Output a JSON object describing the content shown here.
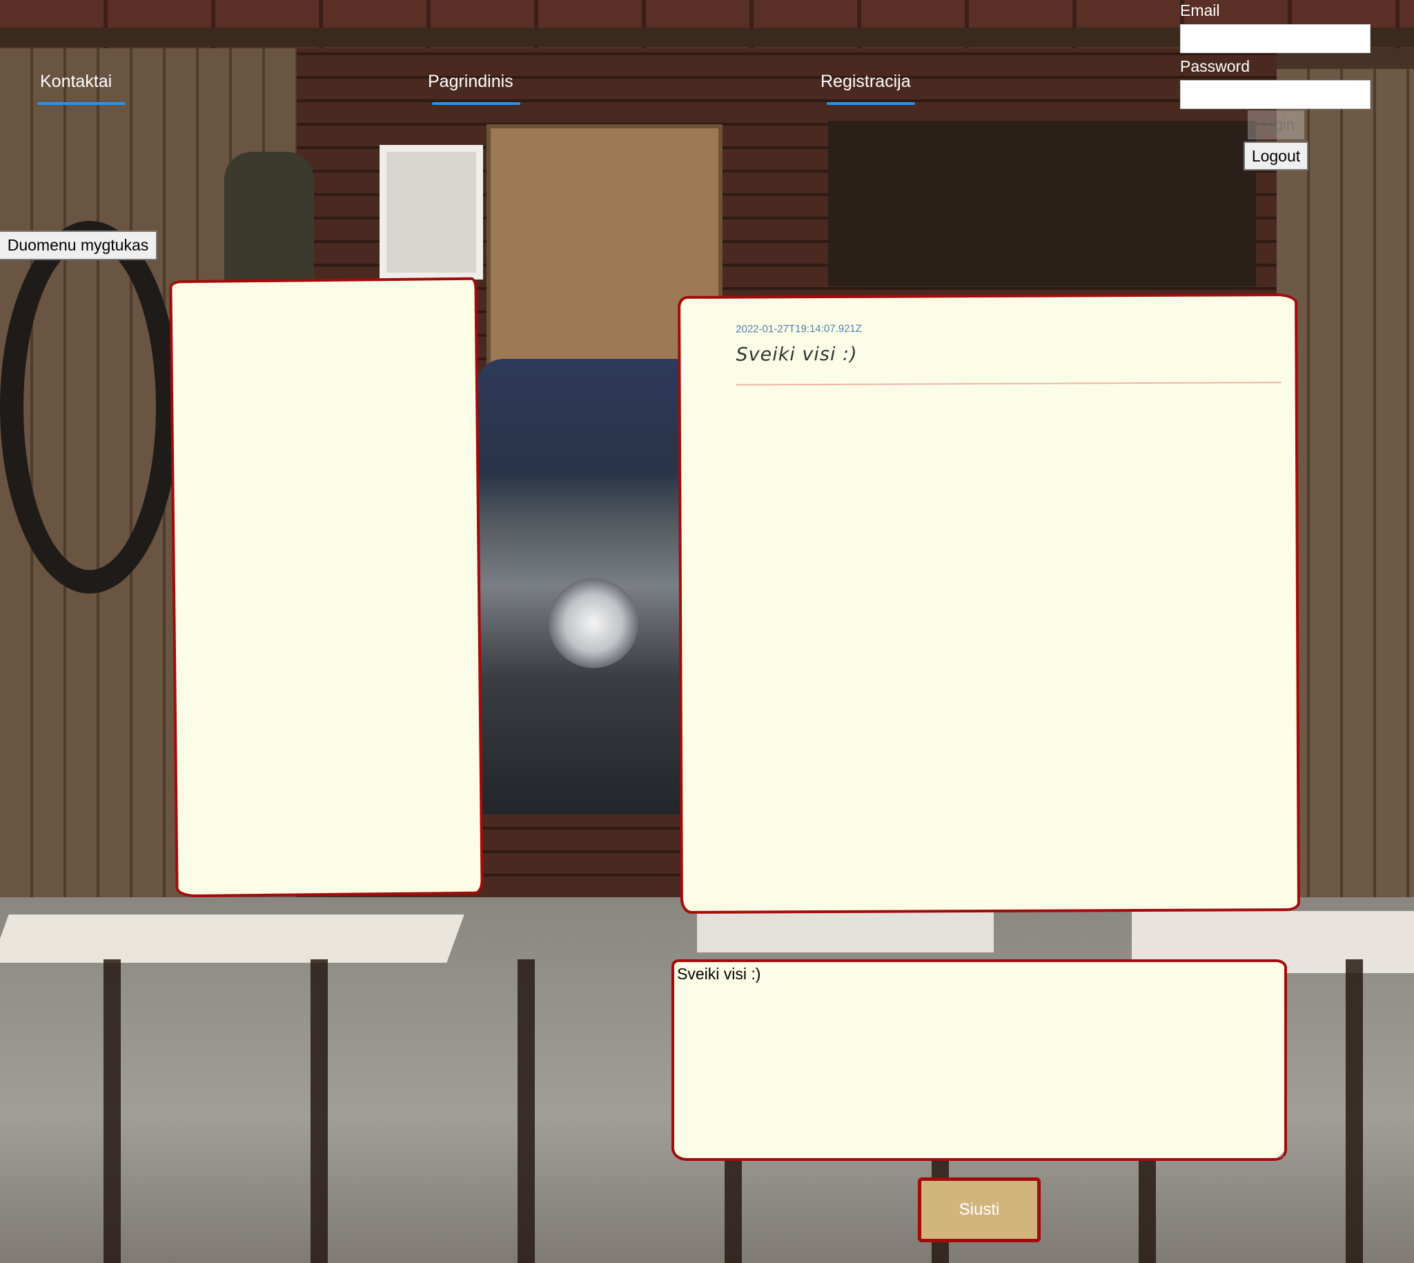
{
  "nav": {
    "links": [
      {
        "label": "Kontaktai"
      },
      {
        "label": "Pagrindinis"
      },
      {
        "label": "Registracija"
      }
    ]
  },
  "auth": {
    "email_label": "Email",
    "email_value": "",
    "password_label": "Password",
    "password_value": "",
    "login_label": "Login",
    "logout_label": "Logout"
  },
  "data_button": {
    "label": "Duomenu mygtukas"
  },
  "messages": [
    {
      "timestamp": "2022-01-27T19:14:07.921Z",
      "text": "Sveiki visi :)"
    }
  ],
  "compose": {
    "value": "Sveiki visi :)",
    "send_label": "Siusti"
  },
  "colors": {
    "panel_background": "#fcfde6",
    "panel_border": "#a30b0b",
    "nav_underline": "#2196f3",
    "send_button": "#d1b57d",
    "timestamp": "#4f7fb0"
  },
  "icons": []
}
